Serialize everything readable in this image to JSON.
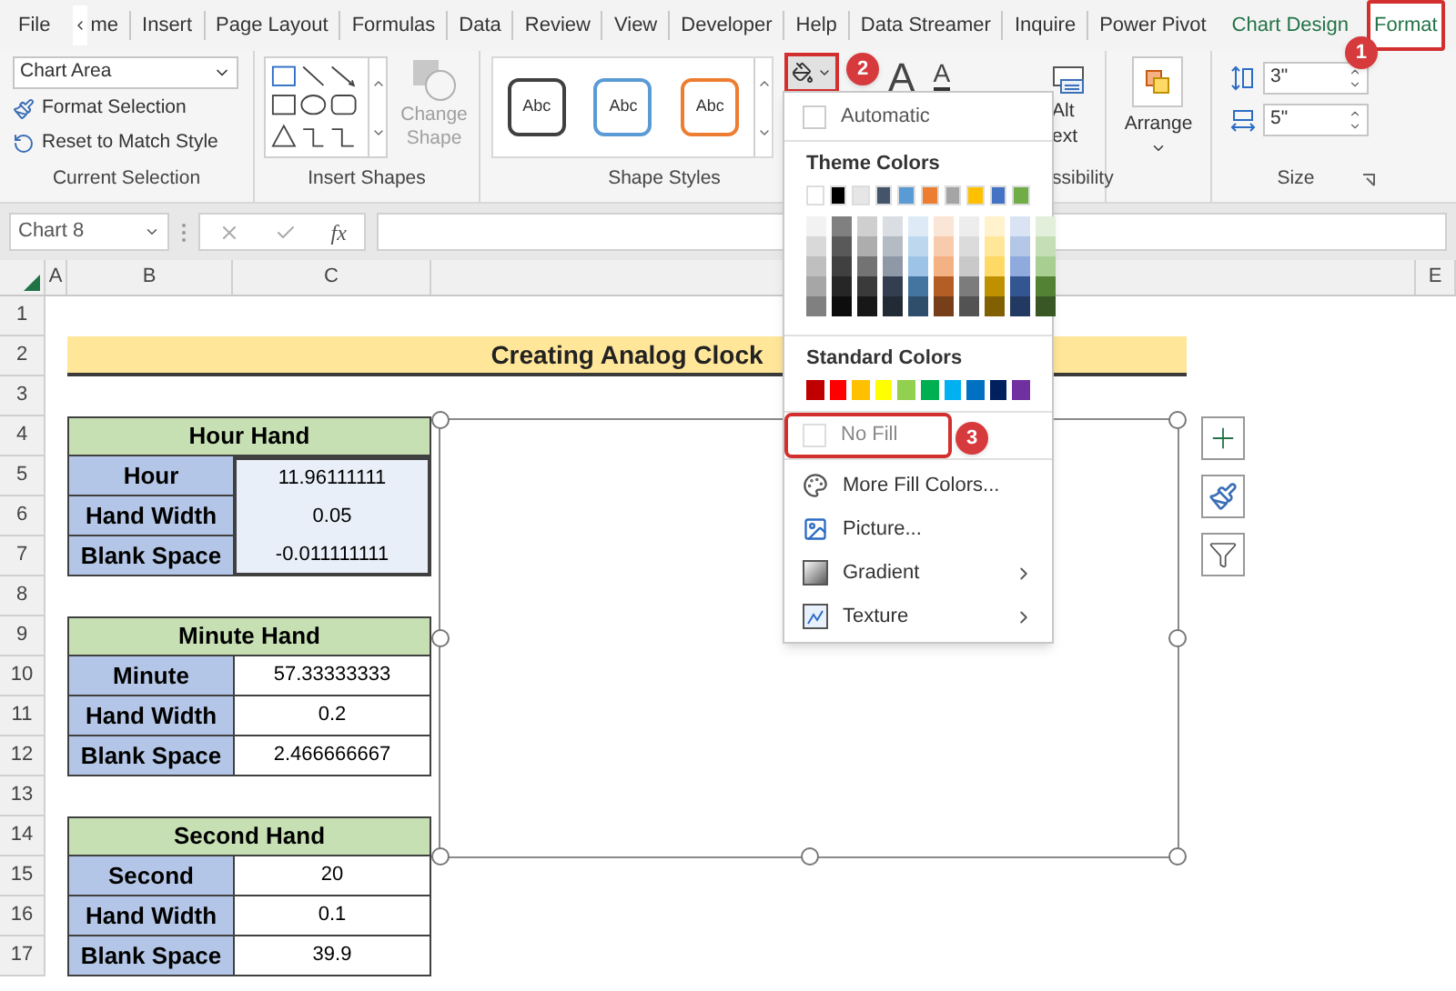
{
  "ribbon_tabs": [
    {
      "label": "File",
      "kind": "standard",
      "selected": false
    },
    {
      "label": "me",
      "kind": "scrolled",
      "selected": false
    },
    {
      "label": "Insert",
      "kind": "standard",
      "selected": false
    },
    {
      "label": "Page Layout",
      "kind": "standard",
      "selected": false
    },
    {
      "label": "Formulas",
      "kind": "standard",
      "selected": false
    },
    {
      "label": "Data",
      "kind": "standard",
      "selected": false
    },
    {
      "label": "Review",
      "kind": "standard",
      "selected": false
    },
    {
      "label": "View",
      "kind": "standard",
      "selected": false
    },
    {
      "label": "Developer",
      "kind": "standard",
      "selected": false
    },
    {
      "label": "Help",
      "kind": "standard",
      "selected": false
    },
    {
      "label": "Data Streamer",
      "kind": "standard",
      "selected": false
    },
    {
      "label": "Inquire",
      "kind": "standard",
      "selected": false
    },
    {
      "label": "Power Pivot",
      "kind": "standard",
      "selected": false
    },
    {
      "label": "Chart Design",
      "kind": "contextual",
      "selected": false
    },
    {
      "label": "Format",
      "kind": "contextual",
      "selected": true,
      "highlighted": true,
      "step": "1"
    }
  ],
  "current_selection": {
    "element": "Chart Area",
    "buttons": [
      "Format Selection",
      "Reset to Match Style"
    ],
    "label": "Current Selection"
  },
  "insert_shapes": {
    "change_shape": "Change Shape",
    "disabled": true,
    "label": "Insert Shapes"
  },
  "shape_styles": {
    "styles": [
      {
        "label": "Abc",
        "color": "#404040"
      },
      {
        "label": "Abc",
        "color": "#5b9bd5"
      },
      {
        "label": "Abc",
        "color": "#ed7d31"
      }
    ],
    "label": "Shape Styles",
    "fill_button": {
      "highlighted": true,
      "step": "2"
    }
  },
  "text_effects": [
    "A",
    "A"
  ],
  "accessibility": {
    "alt_text": [
      "Alt",
      "ext"
    ],
    "label": "ssibility"
  },
  "arrange": {
    "label": "Arrange"
  },
  "size": {
    "height": "3\"",
    "width": "5\"",
    "label": "Size"
  },
  "formula_bar": {
    "name_box": "Chart 8",
    "function_label": "fx"
  },
  "columns": [
    "A",
    "B",
    "C",
    "E"
  ],
  "rows": [
    "1",
    "2",
    "3",
    "4",
    "5",
    "6",
    "7",
    "8",
    "9",
    "10",
    "11",
    "12",
    "13",
    "14",
    "15",
    "16",
    "17"
  ],
  "sheet_title": "Creating Analog Clock",
  "tables": [
    {
      "title": "Hour Hand",
      "selected": true,
      "rows": [
        {
          "label": "Hour",
          "value": "11.96111111"
        },
        {
          "label": "Hand Width",
          "value": "0.05"
        },
        {
          "label": "Blank Space",
          "value": "-0.011111111"
        }
      ]
    },
    {
      "title": "Minute Hand",
      "selected": false,
      "rows": [
        {
          "label": "Minute",
          "value": "57.33333333"
        },
        {
          "label": "Hand Width",
          "value": "0.2"
        },
        {
          "label": "Blank Space",
          "value": "2.466666667"
        }
      ]
    },
    {
      "title": "Second Hand",
      "selected": false,
      "rows": [
        {
          "label": "Second",
          "value": "20"
        },
        {
          "label": "Hand Width",
          "value": "0.1"
        },
        {
          "label": "Blank Space",
          "value": "39.9"
        }
      ]
    }
  ],
  "chart": {
    "selected": true
  },
  "fill_menu": {
    "automatic": "Automatic",
    "theme_heading": "Theme Colors",
    "theme_colors": [
      {
        "color": "#ffffff"
      },
      {
        "color": "#000000"
      },
      {
        "color": "#e7e6e6"
      },
      {
        "color": "#44546a"
      },
      {
        "color": "#5b9bd5"
      },
      {
        "color": "#ed7d31"
      },
      {
        "color": "#a5a5a5"
      },
      {
        "color": "#ffc000"
      },
      {
        "color": "#4472c4"
      },
      {
        "color": "#70ad47"
      }
    ],
    "standard_heading": "Standard Colors",
    "standard_colors": [
      {
        "color": "#c00000"
      },
      {
        "color": "#ff0000"
      },
      {
        "color": "#ffc000"
      },
      {
        "color": "#ffff00"
      },
      {
        "color": "#92d050"
      },
      {
        "color": "#00b050"
      },
      {
        "color": "#00b0f0"
      },
      {
        "color": "#0070c0"
      },
      {
        "color": "#002060"
      },
      {
        "color": "#7030a0"
      }
    ],
    "no_fill": {
      "label": "No Fill",
      "highlighted": true,
      "step": "3"
    },
    "items": [
      {
        "label": "More Fill Colors...",
        "kind": "palette",
        "submenu": false
      },
      {
        "label": "Picture...",
        "kind": "picture",
        "submenu": false
      },
      {
        "label": "Gradient",
        "kind": "gradient",
        "submenu": true
      },
      {
        "label": "Texture",
        "kind": "texture",
        "submenu": true
      }
    ]
  }
}
